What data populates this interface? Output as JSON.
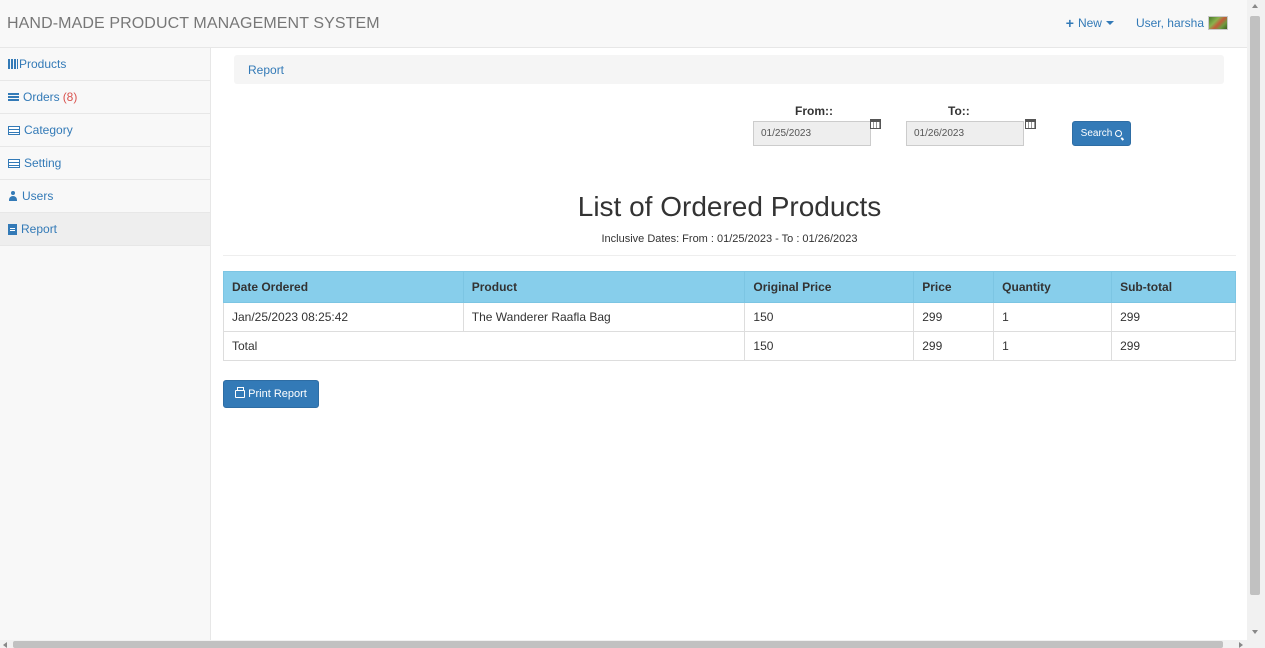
{
  "app": {
    "title": "HAND-MADE PRODUCT MANAGEMENT SYSTEM"
  },
  "nav": {
    "new_label": "New",
    "user_label": "User, harsha"
  },
  "sidebar": {
    "items": [
      {
        "label": "Products",
        "icon": "barcode-icon"
      },
      {
        "label": "Orders",
        "count": "(8)",
        "icon": "list-icon"
      },
      {
        "label": "Category",
        "icon": "card-icon"
      },
      {
        "label": "Setting",
        "icon": "card-icon"
      },
      {
        "label": "Users",
        "icon": "user-icon"
      },
      {
        "label": "Report",
        "icon": "file-icon",
        "active": true
      }
    ]
  },
  "breadcrumb": {
    "label": "Report"
  },
  "filter": {
    "from_label": "From::",
    "from_value": "01/25/2023",
    "to_label": "To::",
    "to_value": "01/26/2023",
    "search_label": "Search"
  },
  "report": {
    "title": "List of Ordered Products",
    "subtitle": "Inclusive Dates: From : 01/25/2023 - To : 01/26/2023"
  },
  "table": {
    "headers": [
      "Date Ordered",
      "Product",
      "Original Price",
      "Price",
      "Quantity",
      "Sub-total"
    ],
    "rows": [
      [
        "Jan/25/2023 08:25:42",
        "The Wanderer Raafla Bag",
        "150",
        "299",
        "1",
        "299"
      ]
    ],
    "total": {
      "label": "Total",
      "original_price": "150",
      "price": "299",
      "quantity": "1",
      "subtotal": "299"
    }
  },
  "print_label": "Print Report",
  "colors": {
    "accent": "#337ab7",
    "table_header": "#87ceeb",
    "badge": "#d9534f"
  }
}
